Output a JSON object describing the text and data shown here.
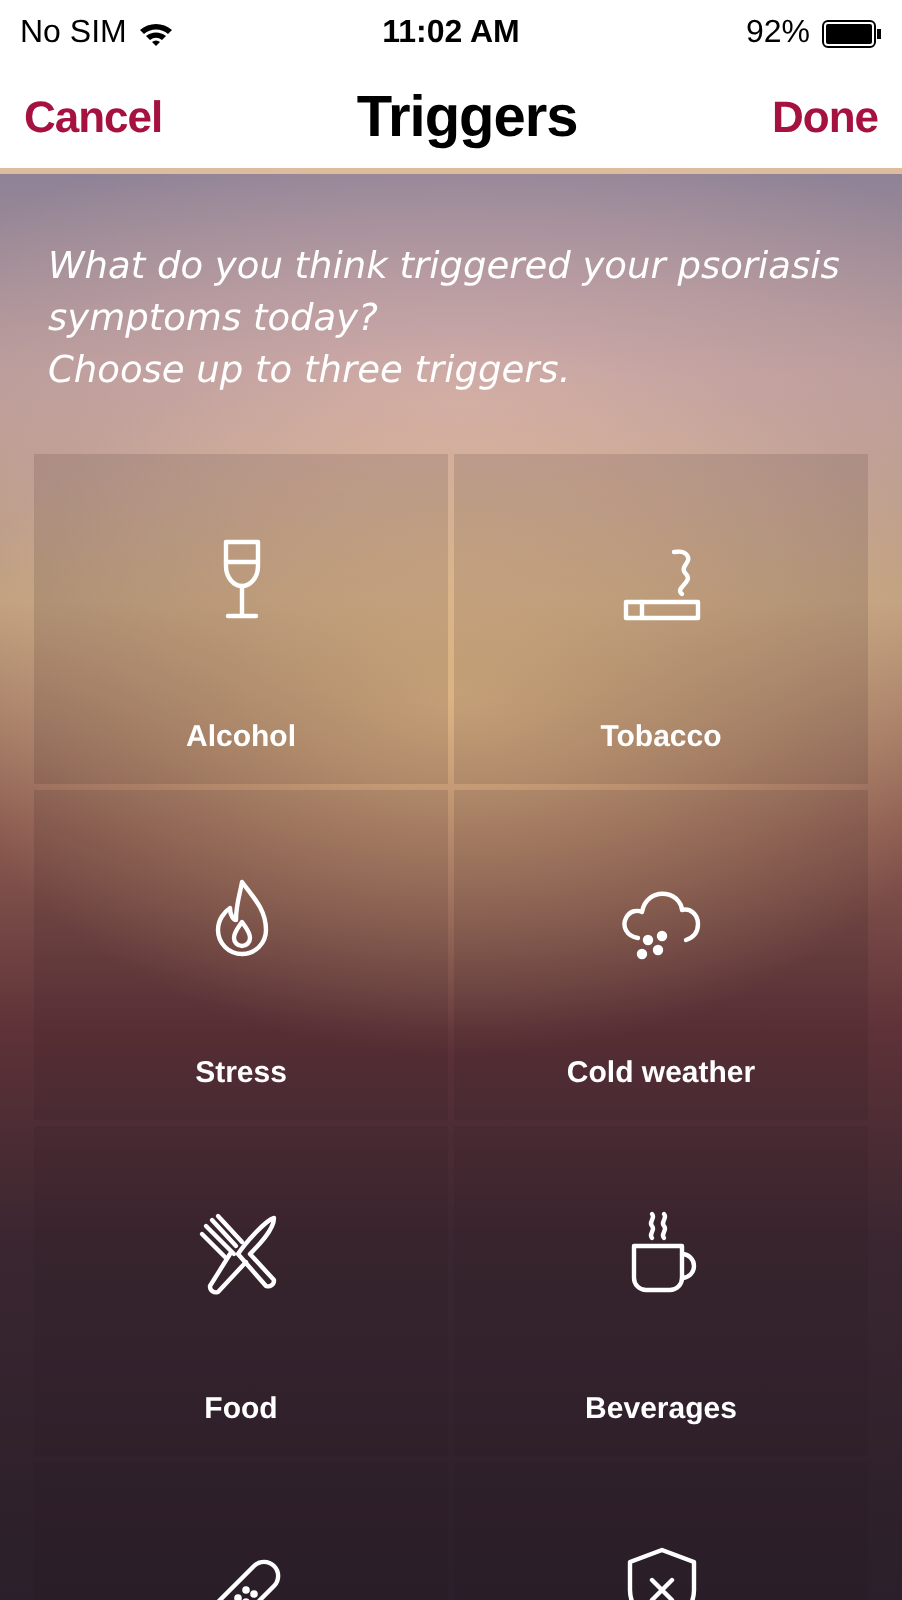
{
  "status_bar": {
    "carrier": "No SIM",
    "time": "11:02 AM",
    "battery": "92%"
  },
  "nav_bar": {
    "cancel": "Cancel",
    "title": "Triggers",
    "done": "Done"
  },
  "prompt": [
    "What do you think triggered your psoriasis symptoms today?",
    "Choose up to three triggers."
  ],
  "triggers": [
    {
      "label": "Alcohol",
      "selected": false
    },
    {
      "label": "Tobacco",
      "selected": false
    },
    {
      "label": "Stress",
      "selected": false
    },
    {
      "label": "Cold weather",
      "selected": false
    },
    {
      "label": "Food",
      "selected": false
    },
    {
      "label": "Beverages",
      "selected": false
    },
    {
      "selected": false
    },
    {
      "selected": false
    }
  ]
}
